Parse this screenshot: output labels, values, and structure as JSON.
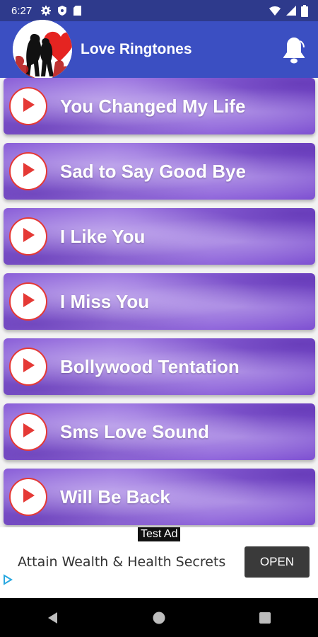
{
  "status_bar": {
    "time": "6:27",
    "left_icons": [
      "gear-icon",
      "shield-icon",
      "sd-card-icon"
    ],
    "right_icons": [
      "wifi-icon",
      "signal-icon",
      "battery-icon"
    ]
  },
  "app_bar": {
    "title": "Love Ringtones",
    "logo_icon": "couple-heart-logo",
    "action_icon": "bell-icon",
    "color": "#3b4fc2"
  },
  "ringtones": [
    {
      "label": "You Changed My Life"
    },
    {
      "label": "Sad to Say Good Bye"
    },
    {
      "label": "I Like You"
    },
    {
      "label": "I Miss You"
    },
    {
      "label": "Bollywood Tentation"
    },
    {
      "label": "Sms Love Sound"
    },
    {
      "label": "Will Be Back"
    }
  ],
  "ad": {
    "badge": "Test Ad",
    "text": "Attain Wealth & Health Secrets",
    "button": "OPEN"
  },
  "nav_bar": {
    "buttons": [
      "back-icon",
      "home-icon",
      "recents-icon"
    ]
  },
  "colors": {
    "accent_red": "#e53935",
    "item_purple": "#8a5fd8",
    "status_bar": "#2e3a8c"
  }
}
